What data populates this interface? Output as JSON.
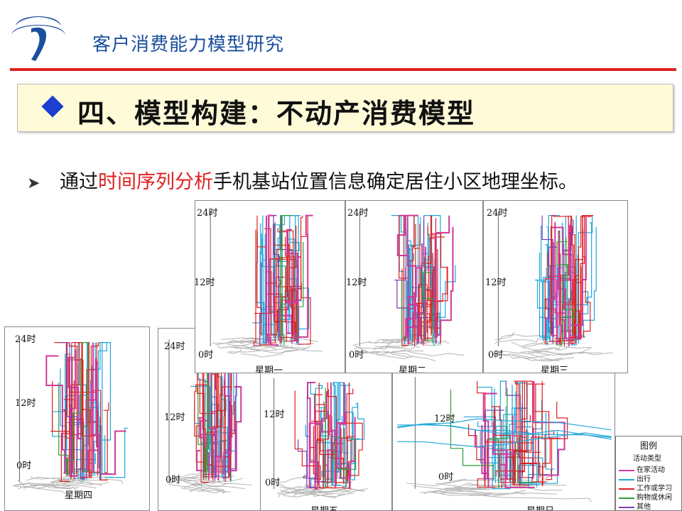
{
  "header": {
    "title": "客户消费能力模型研究"
  },
  "section": {
    "title": "四、模型构建：不动产消费模型"
  },
  "body": {
    "prefix": "通过",
    "highlight": "时间序列分析",
    "suffix": "手机基站位置信息确定居住小区地理坐标。"
  },
  "colors": {
    "brand_blue": "#1a4f9e",
    "rule_red": "#e02020",
    "banner_bg": "#fffbd9",
    "home": "#d0399a",
    "travel": "#22a6d8",
    "work": "#e02020",
    "shopping": "#2e9e3a",
    "other": "#7a3fb0"
  },
  "panels": [
    {
      "day": "星期一",
      "y_top": "24时",
      "y_mid": "12时",
      "y_bottom": "0时"
    },
    {
      "day": "星期二",
      "y_top": "24时",
      "y_mid": "12时",
      "y_bottom": "0时"
    },
    {
      "day": "星期三",
      "y_top": "24时",
      "y_mid": "12时",
      "y_bottom": "0时"
    },
    {
      "day": "星期四",
      "y_top": "24时",
      "y_mid": "12时",
      "y_bottom": "0时"
    },
    {
      "day": "",
      "y_top": "24时",
      "y_mid": "12时",
      "y_bottom": "0时"
    },
    {
      "day": "星期五",
      "y_top": "",
      "y_mid": "12时",
      "y_bottom": "0时"
    },
    {
      "day": "星期日",
      "y_top": "",
      "y_mid": "12时",
      "y_bottom": "0时"
    }
  ],
  "legend": {
    "title": "图例",
    "subtitle": "活动类型",
    "items": [
      {
        "label": "在家活动",
        "color": "#d0399a"
      },
      {
        "label": "出行",
        "color": "#22a6d8"
      },
      {
        "label": "工作或学习",
        "color": "#e02020"
      },
      {
        "label": "购物或休闲",
        "color": "#2e9e3a"
      },
      {
        "label": "其他",
        "color": "#7a3fb0"
      }
    ]
  }
}
